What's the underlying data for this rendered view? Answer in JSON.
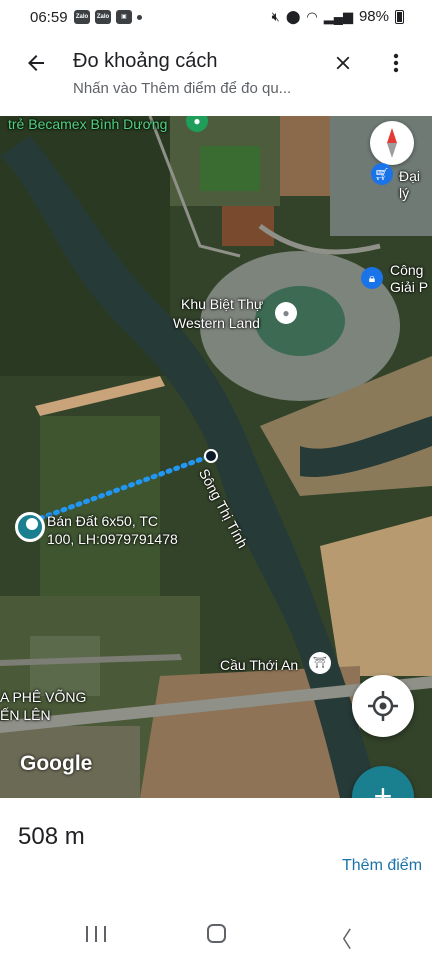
{
  "status_bar": {
    "time": "06:59",
    "notifications": [
      "Zalo",
      "Zalo"
    ],
    "battery": "98%"
  },
  "header": {
    "title": "Đo khoảng cách",
    "subtitle": "Nhấn vào Thêm điểm để đo qu...",
    "back_icon": "arrow-back-icon",
    "close_icon": "close-icon",
    "more_icon": "more-vert-icon"
  },
  "map": {
    "labels": {
      "becamex": "trẻ Becamex Bình Dương",
      "dai_ly": "Đại lý",
      "cong": "Công",
      "giai_p": "Giải P",
      "western_land_1": "Khu Biệt Thự",
      "western_land_2": "Western Land",
      "river": "Sông Thị Tính",
      "listing_1": "Bán Đất 6x50, TC",
      "listing_2": "100, LH:0979791478",
      "cau_thoi_an": "Cầu Thới An",
      "cafe_1": "A PHÊ VÕNG",
      "cafe_2": "ẾN LÊN",
      "google": "Google"
    },
    "measure_color": "#2196f3"
  },
  "sheet": {
    "distance": "508 m",
    "add_point": "Thêm điểm"
  }
}
